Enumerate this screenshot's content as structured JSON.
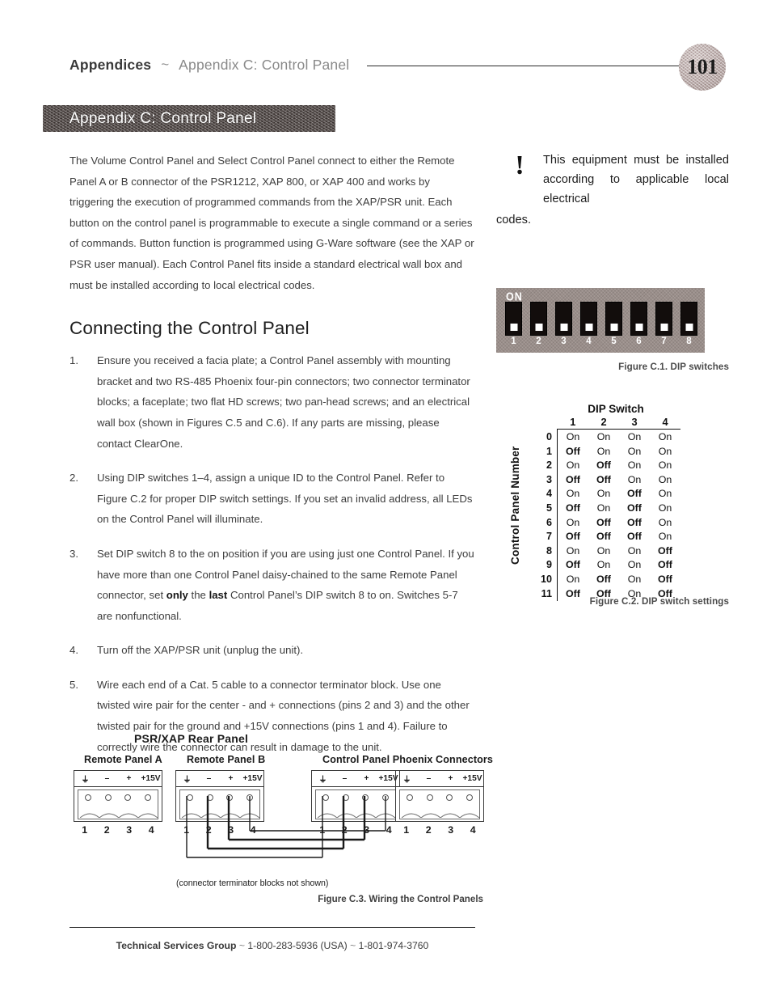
{
  "running_head": {
    "title": "Appendices",
    "separator": "~",
    "subtitle": "Appendix C: Control Panel"
  },
  "page_number": "101",
  "chapter_band": {
    "title": "Appendix C: Control Panel"
  },
  "intro_paragraph": "The Volume Control Panel and Select Control Panel connect to either the Remote Panel A or B connector of the PSR1212, XAP 800, or XAP 400 and works by triggering the execution of programmed commands from the XAP/PSR unit. Each button on the control panel is programmable to execute a single command or a series of commands. Button function is programmed using G-Ware software (see the XAP or PSR user manual). Each Control Panel fits inside a standard electrical wall box and must be installed according to local electrical codes.",
  "warning": {
    "icon": "exclamation-mark",
    "text": "This equipment must be installed according to applicable local electrical",
    "tail": "codes."
  },
  "section": {
    "heading": "Connecting the Control Panel"
  },
  "steps": [
    {
      "number": "1.",
      "text": "Ensure you received a facia plate; a Control Panel assembly with mounting bracket and two RS-485 Phoenix four-pin connectors; two connector terminator blocks; a faceplate; two flat HD screws; two pan-head screws; and an electrical wall box (shown in Figures C.5 and C.6). If any parts are missing, please contact ClearOne."
    },
    {
      "number": "2.",
      "text": "Using DIP switches 1–4, assign a unique ID to the Control Panel. Refer to Figure C.2 for proper DIP switch settings. If you set an invalid address, all LEDs on the Control Panel will illuminate."
    },
    {
      "number": "3.",
      "text_parts": [
        {
          "t": "Set DIP switch 8 to the on position if you are using just one Control Panel. If you have more than one Control Panel daisy-chained to the same Remote Panel connector, set ",
          "bold": false
        },
        {
          "t": "only",
          "bold": true
        },
        {
          "t": " the ",
          "bold": false
        },
        {
          "t": "last",
          "bold": true
        },
        {
          "t": " Control Panel’s DIP switch 8 to on. Switches 5-7 are nonfunctional.",
          "bold": false
        }
      ]
    },
    {
      "number": "4.",
      "text": "Turn off the XAP/PSR unit (unplug the unit)."
    },
    {
      "number": "5.",
      "text": "Wire each end of a Cat. 5 cable to a connector terminator block. Use one twisted wire pair for the center - and + connections (pins 2 and 3) and the other twisted pair for the ground and +15V connections (pins 1 and 4). Failure to correctly wire the connector can result in damage to the unit."
    }
  ],
  "figure_c1": {
    "on_label": "ON",
    "switch_numbers": [
      "1",
      "2",
      "3",
      "4",
      "5",
      "6",
      "7",
      "8"
    ],
    "caption": "Figure C.1. DIP switches"
  },
  "figure_c2": {
    "column_group_title": "DIP Switch",
    "row_axis_label": "Control Panel Number",
    "switch_headers": [
      "1",
      "2",
      "3",
      "4"
    ],
    "rows": [
      {
        "n": "0",
        "cells": [
          "On",
          "On",
          "On",
          "On"
        ]
      },
      {
        "n": "1",
        "cells": [
          "Off",
          "On",
          "On",
          "On"
        ]
      },
      {
        "n": "2",
        "cells": [
          "On",
          "Off",
          "On",
          "On"
        ]
      },
      {
        "n": "3",
        "cells": [
          "Off",
          "Off",
          "On",
          "On"
        ]
      },
      {
        "n": "4",
        "cells": [
          "On",
          "On",
          "Off",
          "On"
        ]
      },
      {
        "n": "5",
        "cells": [
          "Off",
          "On",
          "Off",
          "On"
        ]
      },
      {
        "n": "6",
        "cells": [
          "On",
          "Off",
          "Off",
          "On"
        ]
      },
      {
        "n": "7",
        "cells": [
          "Off",
          "Off",
          "Off",
          "On"
        ]
      },
      {
        "n": "8",
        "cells": [
          "On",
          "On",
          "On",
          "Off"
        ]
      },
      {
        "n": "9",
        "cells": [
          "Off",
          "On",
          "On",
          "Off"
        ]
      },
      {
        "n": "10",
        "cells": [
          "On",
          "Off",
          "On",
          "Off"
        ]
      },
      {
        "n": "11",
        "cells": [
          "Off",
          "Off",
          "On",
          "Off"
        ]
      }
    ],
    "caption": "Figure C.2. DIP switch settings"
  },
  "figure_c3": {
    "title": "PSR/XAP Rear Panel",
    "group_label_right": "Control Panel Phoenix Connectors",
    "connectors": [
      {
        "label": "Remote Panel A",
        "terminals": [
          "⏚",
          "–",
          "+",
          "+15V"
        ],
        "pins": [
          "1",
          "2",
          "3",
          "4"
        ]
      },
      {
        "label": "Remote Panel B",
        "terminals": [
          "⏚",
          "–",
          "+",
          "+15V"
        ],
        "pins": [
          "1",
          "2",
          "3",
          "4"
        ]
      },
      {
        "label": "",
        "terminals": [
          "⏚",
          "–",
          "+",
          "+15V"
        ],
        "pins": [
          "1",
          "2",
          "3",
          "4"
        ]
      },
      {
        "label": "",
        "terminals": [
          "⏚",
          "–",
          "+",
          "+15V"
        ],
        "pins": [
          "1",
          "2",
          "3",
          "4"
        ]
      }
    ],
    "note": "(connector terminator blocks not shown)",
    "caption": "Figure C.3. Wiring the Control Panels"
  },
  "footer": {
    "group": "Technical Services Group",
    "sep1": "~",
    "phone_usa": "1-800-283-5936 (USA)",
    "sep2": "~",
    "phone_intl": "1-801-974-3760"
  }
}
